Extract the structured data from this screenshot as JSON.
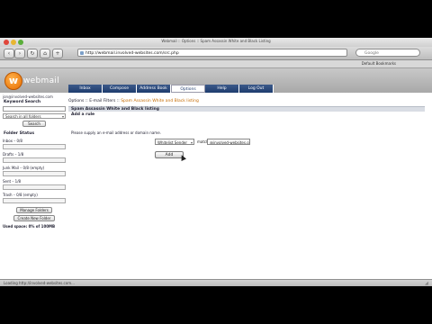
{
  "browser": {
    "title": "Webmail :: Options :: Spam Assassin White and Black Listing",
    "url": "http://webmail.involved-websites.com/src.php",
    "search_placeholder": "Google",
    "bookmark": "Default Bookmarks"
  },
  "app": {
    "logo_letter": "w",
    "logo_text": "webmail",
    "user_email": "jon@involved-websites.com",
    "tabs": [
      {
        "label": "Inbox"
      },
      {
        "label": "Compose"
      },
      {
        "label": "Address Book"
      },
      {
        "label": "Options"
      },
      {
        "label": "Help"
      },
      {
        "label": "Log Out"
      }
    ]
  },
  "sidebar": {
    "keyword_search_title": "Keyword Search",
    "search_input_value": "",
    "search_scope": "Search in all folders",
    "search_button": "Search",
    "folder_status_title": "Folder Status",
    "folders": [
      {
        "label": "Inbox – 0/8",
        "fill": 0.0
      },
      {
        "label": "Drafts – 1/8",
        "fill": 0.0
      },
      {
        "label": "Junk Mail – 0/8 (empty)",
        "fill": 0.0
      },
      {
        "label": "Sent – 1/8",
        "fill": 0.0
      },
      {
        "label": "Trash – 0/8 (empty)",
        "fill": 0.0
      }
    ],
    "manage_folders_button": "Manage Folders",
    "create_folder_button": "Create New Folder",
    "quota": "Used space: 0% of 100MB"
  },
  "main": {
    "breadcrumb_prefix": "Options :: E-mail Filters :: ",
    "breadcrumb_current": "Spam Assassin White and Black listing",
    "panel_title": "Spam Assassin White and Black listing",
    "section_title": "Add a rule",
    "instruction": "Please supply an e-mail address or domain name.",
    "rule_type": "Whitelist Sender",
    "match_label": "match",
    "match_value": "@involved-websites.com",
    "add_button": "Add"
  },
  "statusbar": {
    "text": "Loading http://involved-websites.com..."
  },
  "colors": {
    "tab_bg": "#1e3c6e",
    "accent": "#e86d00"
  }
}
